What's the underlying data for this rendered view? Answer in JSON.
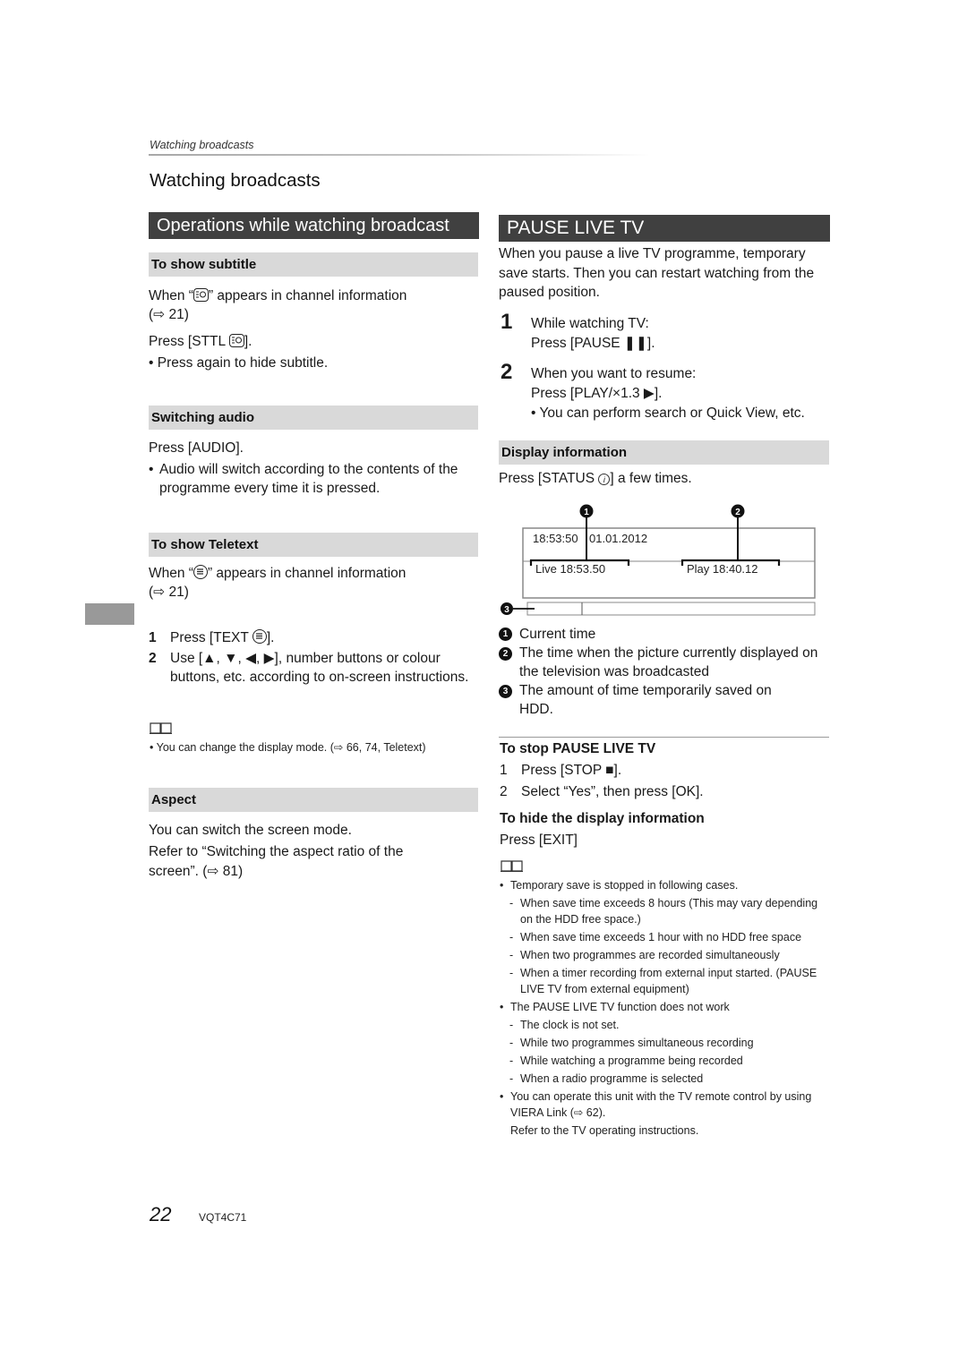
{
  "header": {
    "running_title": "Watching broadcasts",
    "page_title": "Watching broadcasts"
  },
  "left": {
    "banner": "Operations while watching broadcast",
    "subtitle": {
      "heading": "To show subtitle",
      "when_pre": "When “",
      "when_post": "” appears in channel information",
      "ref": "(⇨ 21)",
      "press_pre": "Press [STTL ",
      "press_post": "].",
      "bullet": "• Press again to hide subtitle."
    },
    "audio": {
      "heading": "Switching audio",
      "press": "Press [AUDIO].",
      "bullet_mark": "•",
      "bullet": "Audio will switch according to the contents of the programme every time it is pressed."
    },
    "teletext": {
      "heading": "To show Teletext",
      "when_pre": "When “",
      "when_post": "” appears in channel information",
      "ref": "(⇨ 21)",
      "steps": [
        {
          "num": "1",
          "pre": "Press [TEXT ",
          "post": "]."
        },
        {
          "num": "2",
          "text": "Use [▲, ▼, ◀, ▶], number buttons or colour buttons, etc. according to on-screen instructions."
        }
      ],
      "note": "•  You can change the display mode. (⇨ 66, 74, Teletext)"
    },
    "aspect": {
      "heading": "Aspect",
      "line1": "You can switch the screen mode.",
      "line2": "Refer to “Switching the aspect ratio of the screen”. (⇨ 81)"
    }
  },
  "right": {
    "banner": "PAUSE LIVE TV",
    "intro": "When you pause a live TV programme, temporary save starts. Then you can restart watching from the paused position.",
    "steps": [
      {
        "num": "1",
        "line1": "While watching TV:",
        "line2": "Press [PAUSE ❚❚]."
      },
      {
        "num": "2",
        "line1": "When you want to resume:",
        "line2": "Press [PLAY/×1.3 ▶].",
        "bullet": "• You can perform search or Quick View, etc."
      }
    ],
    "display_info": {
      "heading": "Display information",
      "press_pre": "Press [STATUS ",
      "press_post": "] a few times.",
      "info_glyph": "i",
      "diagram": {
        "clock": "18:53:50",
        "date": "01.01.2012",
        "live_label": "Live  18:53.50",
        "play_label": "Play  18:40.12",
        "saved_fraction": 0.19,
        "badges": [
          "1",
          "2",
          "3"
        ]
      },
      "callouts": [
        {
          "badge": "1",
          "text": "Current time"
        },
        {
          "badge": "2",
          "text": "The time when the picture currently displayed on the television was broadcasted"
        },
        {
          "badge": "3",
          "text": "The amount of time temporarily saved on HDD."
        }
      ]
    },
    "stop": {
      "heading": "To stop PAUSE LIVE TV",
      "steps": [
        {
          "num": "1",
          "text": "Press [STOP ■]."
        },
        {
          "num": "2",
          "text": "Select “Yes”, then press [OK]."
        }
      ]
    },
    "hide": {
      "heading": "To hide the display information",
      "press": "Press [EXIT]"
    },
    "notes": [
      {
        "kind": "bullet",
        "text": "Temporary save is stopped in following cases."
      },
      {
        "kind": "dash",
        "text": "When save time exceeds 8 hours (This may vary depending on the HDD free space.)"
      },
      {
        "kind": "dash",
        "text": "When save time exceeds 1 hour with no HDD free space"
      },
      {
        "kind": "dash",
        "text": "When two programmes are recorded simultaneously"
      },
      {
        "kind": "dash",
        "text": "When a timer recording from external input started. (PAUSE LIVE TV from external equipment)"
      },
      {
        "kind": "bullet",
        "text": "The PAUSE LIVE TV function does not work"
      },
      {
        "kind": "dash",
        "text": "The clock is not set."
      },
      {
        "kind": "dash",
        "text": "While two programmes simultaneous recording"
      },
      {
        "kind": "dash",
        "text": "While watching a programme being recorded"
      },
      {
        "kind": "dash",
        "text": "When a radio programme is selected"
      },
      {
        "kind": "bullet",
        "text": "You can operate this unit with the TV remote control by using VIERA Link (⇨ 62)."
      },
      {
        "kind": "plain",
        "text": "Refer to the TV operating instructions."
      }
    ]
  },
  "footer": {
    "page_number": "22",
    "doc_code": "VQT4C71"
  }
}
